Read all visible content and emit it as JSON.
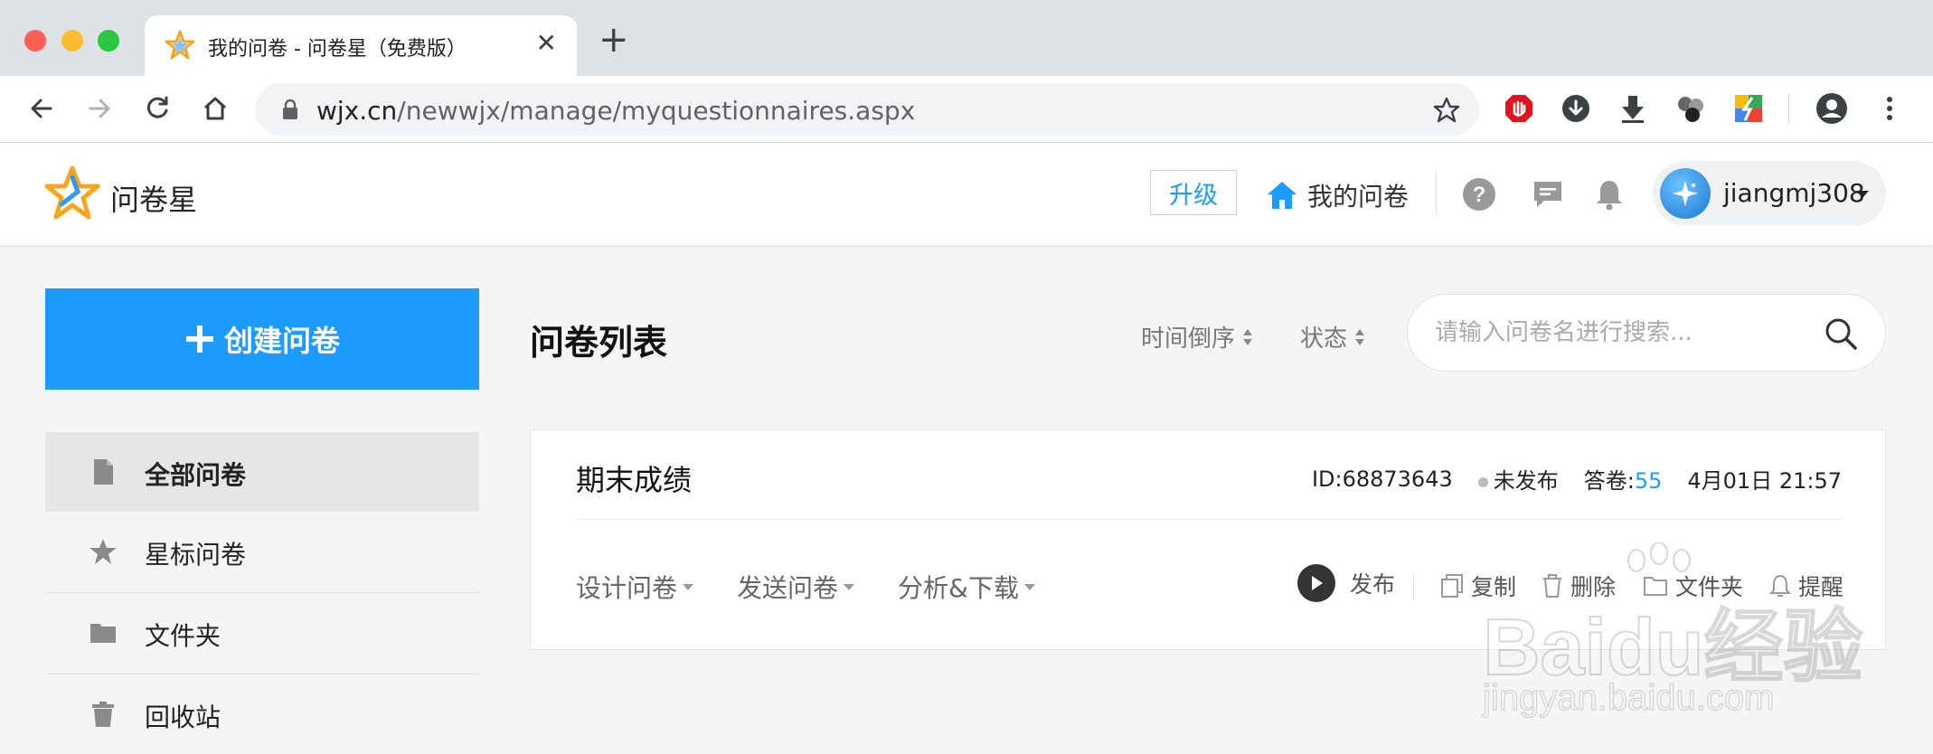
{
  "browser": {
    "tab_title": "我的问卷 - 问卷星（免费版）",
    "url_domain": "wjx.cn",
    "url_path": "/newwjx/manage/myquestionnaires.aspx"
  },
  "header": {
    "brand": "问卷星",
    "upgrade_label": "升级",
    "my_surveys_label": "我的问卷",
    "username": "jiangmj308"
  },
  "sidebar": {
    "create_label": "创建问卷",
    "items": [
      {
        "label": "全部问卷",
        "icon": "document-icon",
        "active": true
      },
      {
        "label": "星标问卷",
        "icon": "star-icon",
        "active": false
      },
      {
        "label": "文件夹",
        "icon": "folder-icon",
        "active": false
      },
      {
        "label": "回收站",
        "icon": "trash-icon",
        "active": false
      }
    ]
  },
  "main": {
    "title": "问卷列表",
    "sort_time_label": "时间倒序",
    "sort_status_label": "状态",
    "search_placeholder": "请输入问卷名进行搜索..."
  },
  "survey": {
    "title": "期末成绩",
    "id": "ID:68873643",
    "status": "未发布",
    "answers_label": "答卷:",
    "answers_count": "55",
    "date": "4月01日 21:57",
    "menus": [
      "设计问卷",
      "发送问卷",
      "分析&下载"
    ],
    "actions": {
      "publish": "发布",
      "copy": "复制",
      "delete": "删除",
      "folder": "文件夹",
      "remind": "提醒"
    }
  },
  "watermark": {
    "line1": "Baidu经验",
    "line2": "jingyan.baidu.com"
  },
  "colors": {
    "accent": "#1e9bff",
    "tab_bar": "#dee1e6",
    "page_bg": "#f5f5f5"
  }
}
